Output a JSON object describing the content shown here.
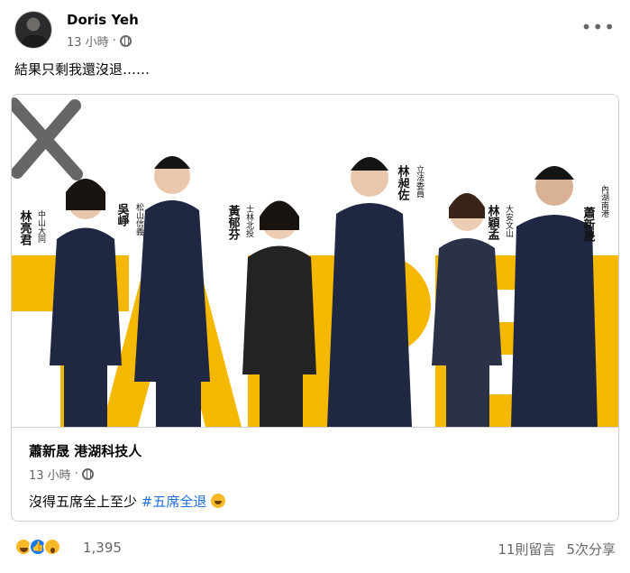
{
  "post": {
    "author": "Doris Yeh",
    "time": "13 小時",
    "separator": "·",
    "text": "結果只剩我還沒退……",
    "more_label": "•••"
  },
  "shared": {
    "image": {
      "banner": "TAIPEI",
      "colors": {
        "yellow": "#f5b800",
        "suit": "#1f2742",
        "background": "#ffffff"
      },
      "candidates": [
        {
          "name": "林亮君",
          "district": "中山大同"
        },
        {
          "name": "吳崢",
          "district": "松山信義"
        },
        {
          "name": "黃郁芬",
          "district": "士林北投"
        },
        {
          "name": "林昶佐",
          "district": "立法委員"
        },
        {
          "name": "林穎孟",
          "district": "大安文山"
        },
        {
          "name": "蕭新晟",
          "district": "內湖南港"
        }
      ]
    },
    "author": "蕭新晟 港湖科技人",
    "time": "13 小時",
    "separator": "·",
    "text_prefix": "沒得五席全上至少 ",
    "hashtag": "#五席全退"
  },
  "footer": {
    "reaction_count": "1,395",
    "comments": "11則留言",
    "shares": "5次分享"
  }
}
